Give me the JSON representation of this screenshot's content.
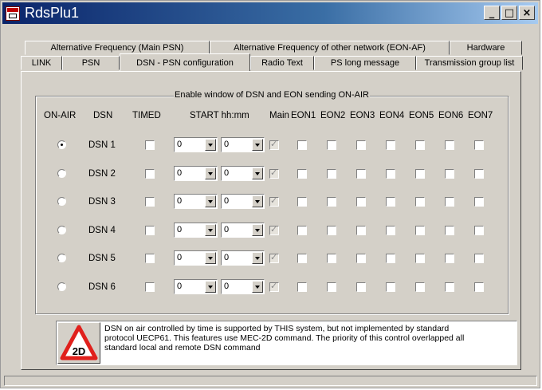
{
  "window": {
    "title": "RdsPlu1",
    "minimize": "_",
    "maximize": "□",
    "close": "×"
  },
  "tabs": {
    "row1": [
      "Alternative Frequency (Main PSN)",
      "Alternative Frequency of other network (EON-AF)",
      "Hardware"
    ],
    "row2": [
      "LINK",
      "PSN",
      "DSN - PSN configuration",
      "Radio Text",
      "PS long message",
      "Transmission group list"
    ],
    "active": "DSN - PSN configuration"
  },
  "group": {
    "title": "Enable window of DSN and EON sending ON-AIR"
  },
  "headers": {
    "onair": "ON-AIR",
    "dsn": "DSN",
    "timed": "TIMED",
    "start": "START hh:mm",
    "main": "Main",
    "eon": [
      "EON1",
      "EON2",
      "EON3",
      "EON4",
      "EON5",
      "EON6",
      "EON7"
    ]
  },
  "rows": [
    {
      "label": "DSN 1",
      "onair": true,
      "timed": false,
      "hh": "0",
      "mm": "0",
      "main": true
    },
    {
      "label": "DSN 2",
      "onair": false,
      "timed": false,
      "hh": "0",
      "mm": "0",
      "main": true
    },
    {
      "label": "DSN 3",
      "onair": false,
      "timed": false,
      "hh": "0",
      "mm": "0",
      "main": true
    },
    {
      "label": "DSN 4",
      "onair": false,
      "timed": false,
      "hh": "0",
      "mm": "0",
      "main": true
    },
    {
      "label": "DSN 5",
      "onair": false,
      "timed": false,
      "hh": "0",
      "mm": "0",
      "main": true
    },
    {
      "label": "DSN 6",
      "onair": false,
      "timed": false,
      "hh": "0",
      "mm": "0",
      "main": true
    }
  ],
  "info": {
    "badge": "2D",
    "line1": "DSN on air controlled by time is supported by THIS system, but not implemented by standard",
    "line2": "protocol UECP61. This features use MEC-2D command. The priority of this control overlapped all",
    "line3": "standard local and remote DSN command"
  },
  "colors": {
    "warning_red": "#e0201c",
    "titlebar": "#0a246a"
  }
}
